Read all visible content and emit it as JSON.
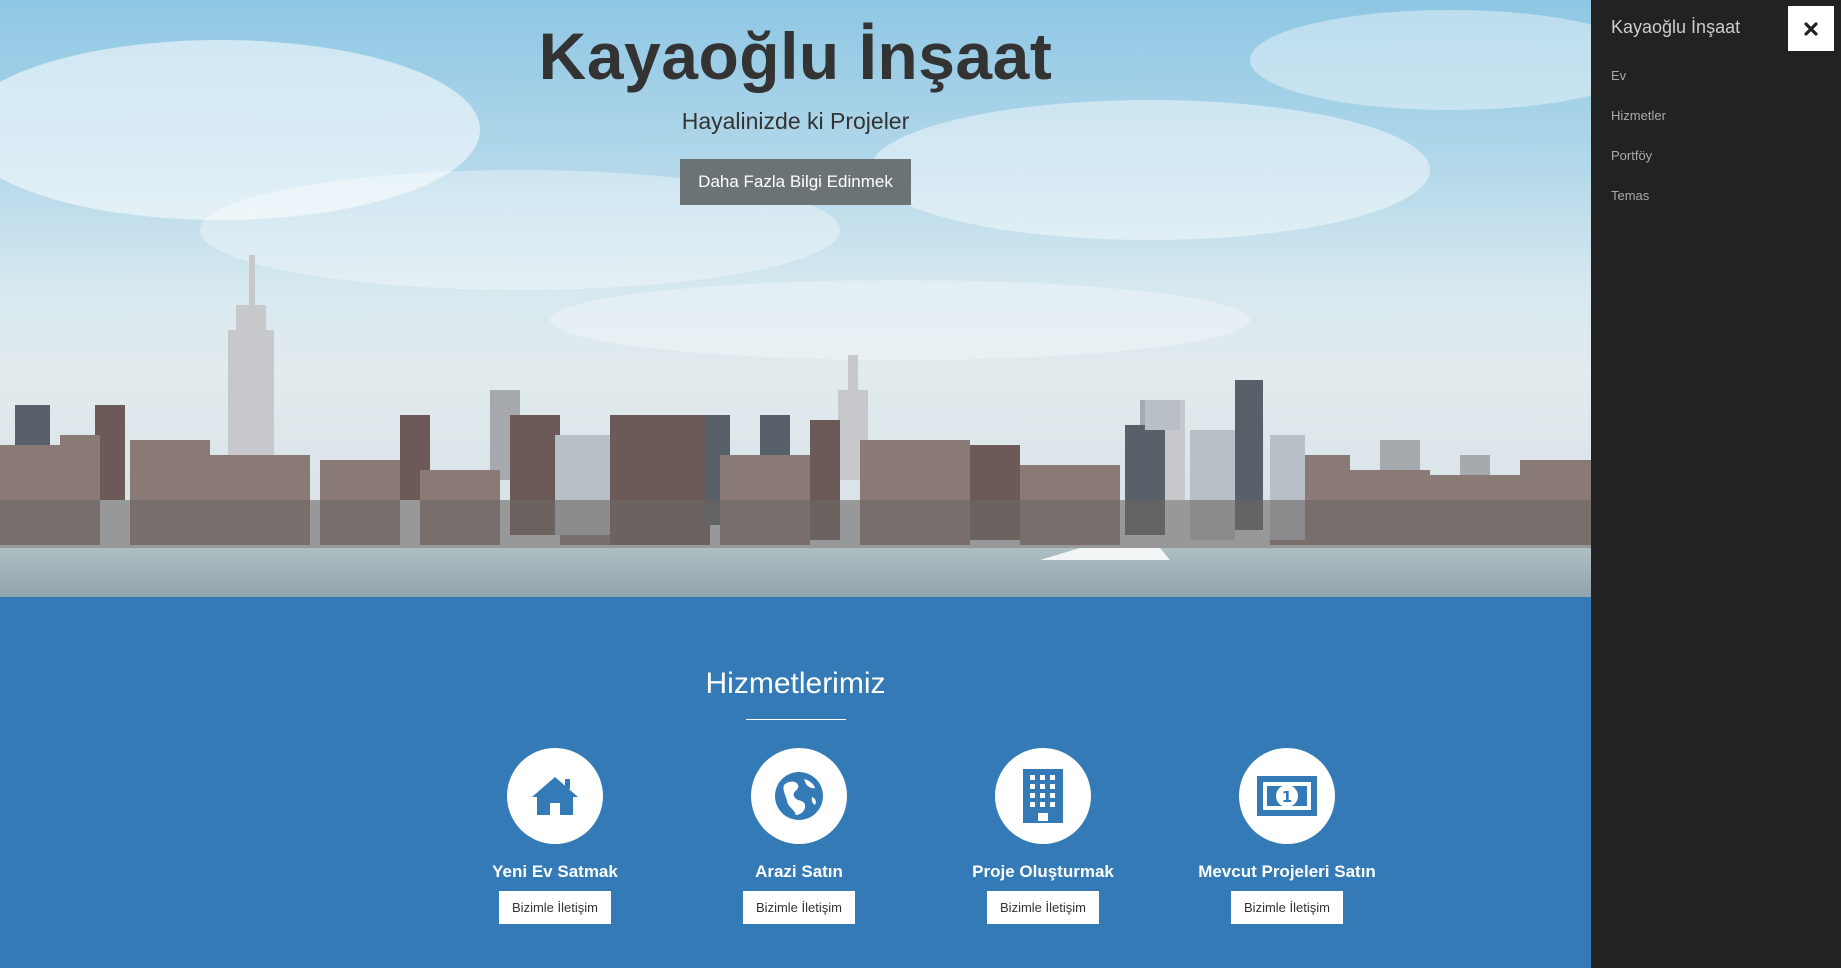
{
  "hero": {
    "title": "Kayaoğlu İnşaat",
    "subtitle": "Hayalinizde ki Projeler",
    "button_label": "Daha Fazla Bilgi Edinmek"
  },
  "services": {
    "title": "Hizmetlerimiz",
    "items": [
      {
        "title": "Yeni Ev Satmak",
        "icon": "home-icon",
        "button_label": "Bizimle İletişim"
      },
      {
        "title": "Arazi Satın",
        "icon": "globe-icon",
        "button_label": "Bizimle İletişim"
      },
      {
        "title": "Proje Oluşturmak",
        "icon": "building-icon",
        "button_label": "Bizimle İletişim"
      },
      {
        "title": "Mevcut Projeleri Satın",
        "icon": "money-icon",
        "button_label": "Bizimle İletişim"
      }
    ]
  },
  "sidebar": {
    "brand": "Kayaoğlu İnşaat",
    "close_icon": "close-icon",
    "items": [
      {
        "label": "Ev"
      },
      {
        "label": "Hizmetler"
      },
      {
        "label": "Portföy"
      },
      {
        "label": "Temas"
      }
    ]
  },
  "colors": {
    "accent": "#337ab7",
    "sidebar": "#222222",
    "hero_button": "#6b7375"
  }
}
